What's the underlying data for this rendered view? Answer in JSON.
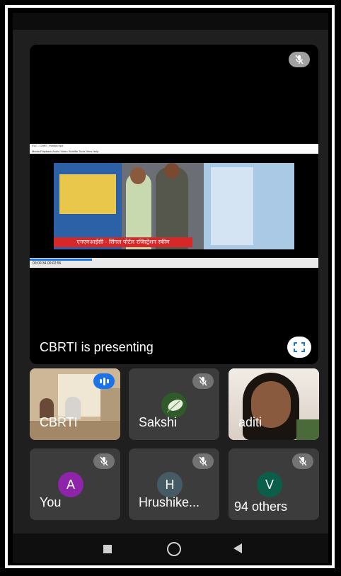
{
  "presentation": {
    "presenter_label": "CBRTI is presenting",
    "mic_icon": "mic-off-icon",
    "fullscreen_icon": "fullscreen-icon",
    "shared_screen": {
      "window_title": "VLC - CBRT_media.mp4",
      "menu_text": "Media  Playback  Audio  Video  Subtitle  Tools  View  Help",
      "caption": "एनएमआईसी - सिंगल पोर्टल रजिस्ट्रेशन स्कीम",
      "time_text": "00:00:34  00:02:56"
    }
  },
  "participants": [
    {
      "name": "CBRTI",
      "state": "speaking",
      "icon": "speaking-indicator-icon"
    },
    {
      "name": "Sakshi",
      "state": "muted",
      "icon": "mic-off-icon"
    },
    {
      "name": "aditi",
      "state": "video"
    },
    {
      "name": "You",
      "initial": "A",
      "state": "muted",
      "color": "#8e24aa"
    },
    {
      "name": "Hrushike...",
      "initial": "H",
      "state": "muted",
      "color": "#455a64"
    },
    {
      "name": "94 others",
      "initial": "V",
      "state": "muted",
      "color": "#0b5e49"
    }
  ],
  "navbar": {
    "recents_icon": "recents-icon",
    "home_icon": "home-icon",
    "back_icon": "back-icon"
  }
}
